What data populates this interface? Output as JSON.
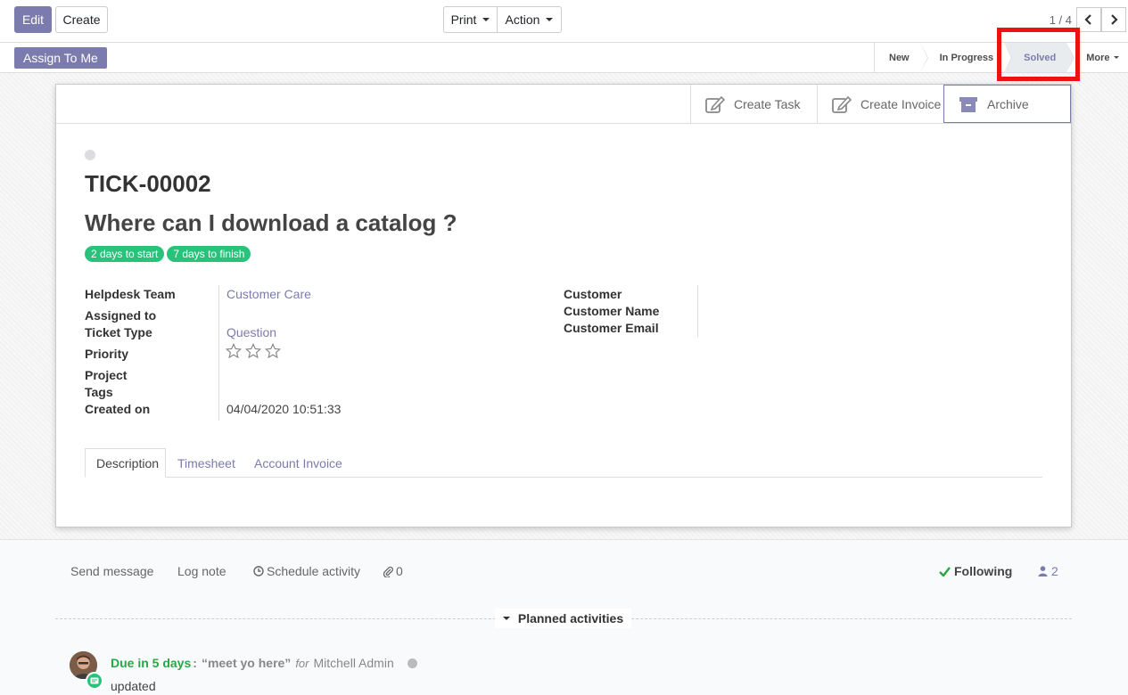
{
  "toolbar": {
    "edit_label": "Edit",
    "create_label": "Create",
    "print_label": "Print",
    "action_label": "Action",
    "pager_value": "1 / 4"
  },
  "statusbar": {
    "assign_label": "Assign To Me",
    "stages": [
      {
        "label": "New",
        "active": false
      },
      {
        "label": "In Progress",
        "active": false
      },
      {
        "label": "Solved",
        "active": true
      }
    ],
    "more_label": "More"
  },
  "smart_buttons": {
    "create_task": "Create Task",
    "create_invoice": "Create Invoice",
    "archive": "Archive"
  },
  "ticket": {
    "reference": "TICK-00002",
    "name": "Where can I download a catalog ?",
    "badges": [
      "2 days to start",
      "7 days to finish"
    ],
    "fields_left": {
      "helpdesk_team_label": "Helpdesk Team",
      "helpdesk_team_value": "Customer Care",
      "assigned_to_label": "Assigned to",
      "ticket_type_label": "Ticket Type",
      "ticket_type_value": "Question",
      "priority_label": "Priority",
      "priority_value": 0,
      "priority_max": 3,
      "project_label": "Project",
      "tags_label": "Tags",
      "created_on_label": "Created on",
      "created_on_value": "04/04/2020 10:51:33"
    },
    "fields_right": {
      "customer_label": "Customer",
      "customer_name_label": "Customer Name",
      "customer_email_label": "Customer Email"
    },
    "tabs": [
      {
        "label": "Description",
        "active": true
      },
      {
        "label": "Timesheet",
        "active": false
      },
      {
        "label": "Account Invoice",
        "active": false
      }
    ]
  },
  "chatter": {
    "send_message": "Send message",
    "log_note": "Log note",
    "schedule_activity": "Schedule activity",
    "attachments_count": "0",
    "following_label": "Following",
    "followers_count": "2",
    "planned_activities_label": "Planned activities",
    "activity": {
      "due": "Due in 5 days",
      "summary": "“meet yo here”",
      "for_label": "for",
      "user": "Mitchell Admin",
      "note": "updated"
    }
  },
  "colors": {
    "brand": "#7c7bad",
    "success": "#28c27a",
    "highlight": "#ee1111"
  }
}
